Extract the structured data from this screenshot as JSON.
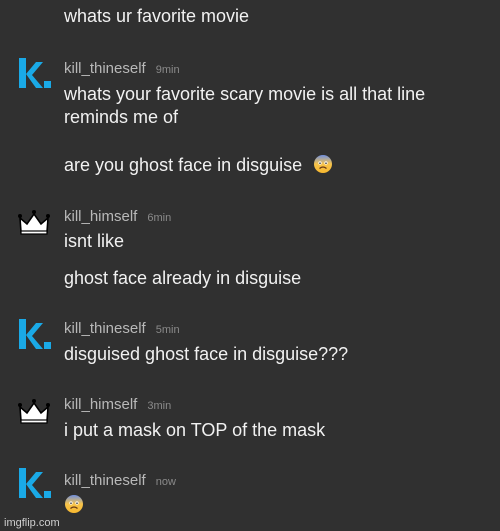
{
  "messages": [
    {
      "lines": [
        "whats ur favorite movie"
      ]
    },
    {
      "author": "kill_thineself",
      "time": "9min",
      "lines": [
        "whats your favorite scary movie is all that line",
        "reminds me of",
        "are you ghost face in disguise"
      ]
    },
    {
      "author": "kill_himself",
      "time": "6min",
      "lines": [
        "isnt like",
        "ghost face already in disguise"
      ]
    },
    {
      "author": "kill_thineself",
      "time": "5min",
      "lines": [
        "disguised ghost face in disguise???"
      ]
    },
    {
      "author": "kill_himself",
      "time": "3min",
      "lines": [
        "i put a mask on TOP of the mask"
      ]
    },
    {
      "author": "kill_thineself",
      "time": "now",
      "lines": [
        ""
      ]
    }
  ],
  "emoji_names": {
    "fearful": "fearful-face-icon"
  },
  "colors": {
    "background": "#303030",
    "brand_k": "#1aa9e6",
    "text": "#f1f1f1",
    "username": "#b8b8b8",
    "timestamp": "#8a8a8a"
  },
  "watermark": "imgflip.com"
}
